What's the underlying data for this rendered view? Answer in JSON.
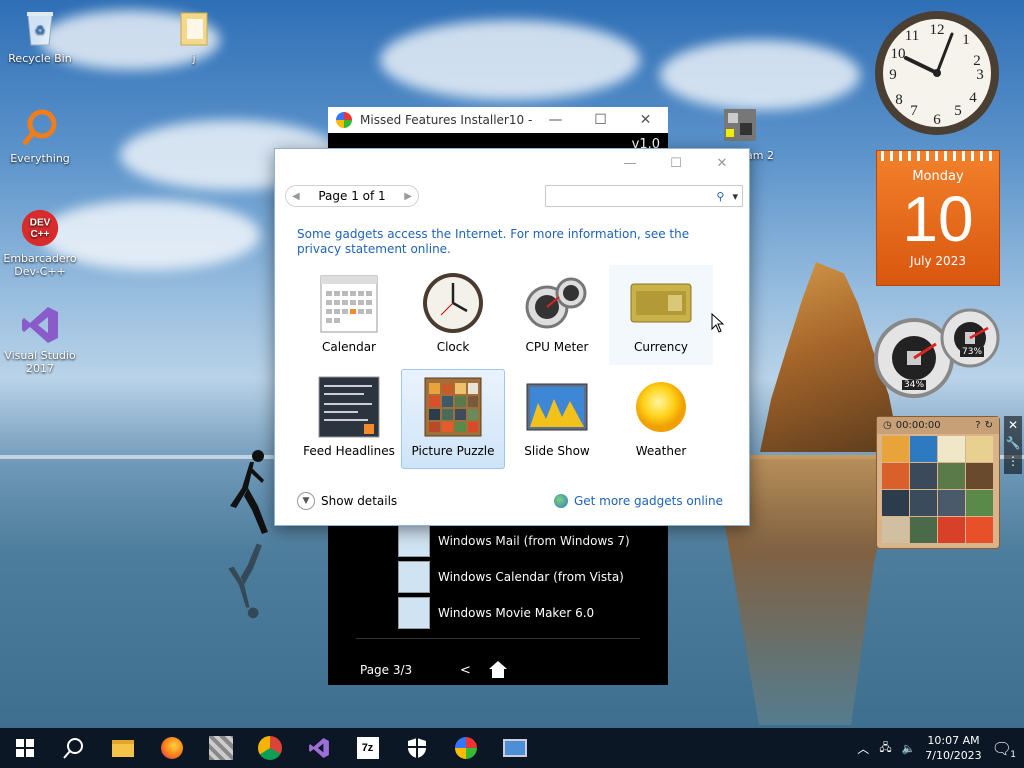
{
  "desktop": {
    "icons": [
      {
        "label": "Recycle Bin"
      },
      {
        "label": "j"
      },
      {
        "label": "Everything"
      },
      {
        "label": "Embarcadero Dev-C++"
      },
      {
        "label": "Visual Studio 2017"
      },
      {
        "label": "am 2"
      }
    ]
  },
  "back_window": {
    "title": "Missed Features Installer10 - M...",
    "version": "v1.0",
    "features": [
      {
        "label": "Windows Mail (from Windows 7)"
      },
      {
        "label": "Windows Calendar (from Vista)"
      },
      {
        "label": "Windows Movie Maker 6.0"
      }
    ],
    "page_label": "Page 3/3",
    "back_label": "<"
  },
  "gallery": {
    "page_label": "Page 1 of 1",
    "notice": "Some gadgets access the Internet.  For more information, see the privacy statement online.",
    "gadgets": [
      {
        "label": "Calendar",
        "selected": false
      },
      {
        "label": "Clock",
        "selected": false
      },
      {
        "label": "CPU Meter",
        "selected": false
      },
      {
        "label": "Currency",
        "selected": false
      },
      {
        "label": "Feed Headlines",
        "selected": false
      },
      {
        "label": "Picture Puzzle",
        "selected": true
      },
      {
        "label": "Slide Show",
        "selected": false
      },
      {
        "label": "Weather",
        "selected": false
      }
    ],
    "show_details": "Show details",
    "get_more": "Get more gadgets online"
  },
  "gadgets_right": {
    "calendar": {
      "weekday": "Monday",
      "day": "10",
      "month_year": "July 2023"
    },
    "cpu": {
      "cpu_percent": "34%",
      "memory_percent": "73%"
    },
    "puzzle": {
      "timer": "00:00:00"
    }
  },
  "taskbar": {
    "time": "10:07 AM",
    "date": "7/10/2023",
    "notification_count": "1"
  }
}
